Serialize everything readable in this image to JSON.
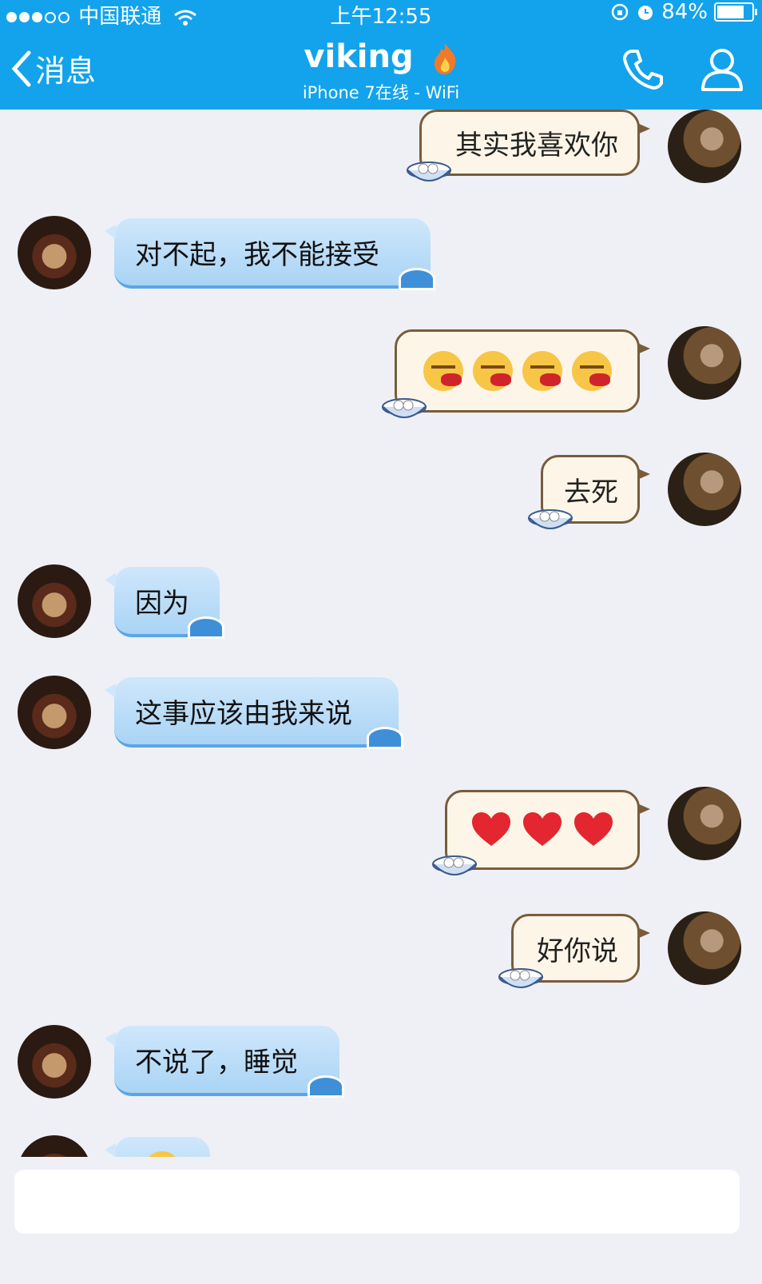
{
  "status": {
    "carrier": "中国联通",
    "time": "上午12:55",
    "battery": "84%",
    "battery_level": 0.84
  },
  "header": {
    "back_label": "消息",
    "title": "viking",
    "subtitle": "iPhone 7在线 - WiFi"
  },
  "messages": [
    {
      "side": "right",
      "text": "其实我喜欢你"
    },
    {
      "side": "left",
      "text": "对不起，我不能接受"
    },
    {
      "side": "right",
      "emoji": "blood-face-emoji",
      "count": 4
    },
    {
      "side": "right",
      "text": "去死"
    },
    {
      "side": "left",
      "text": "因为"
    },
    {
      "side": "left",
      "text": "这事应该由我来说"
    },
    {
      "side": "right",
      "emoji": "red-heart-emoji",
      "count": 3
    },
    {
      "side": "right",
      "text": "好你说"
    },
    {
      "side": "left",
      "text": "不说了，睡觉"
    },
    {
      "side": "left",
      "emoji": "smile-emoji",
      "count": 1
    }
  ],
  "input": {
    "placeholder": ""
  },
  "colors": {
    "header": "#12a3ec",
    "background": "#eef0f6",
    "left_bubble": "#bfe0f8",
    "right_bubble": "#fdf6e8"
  }
}
